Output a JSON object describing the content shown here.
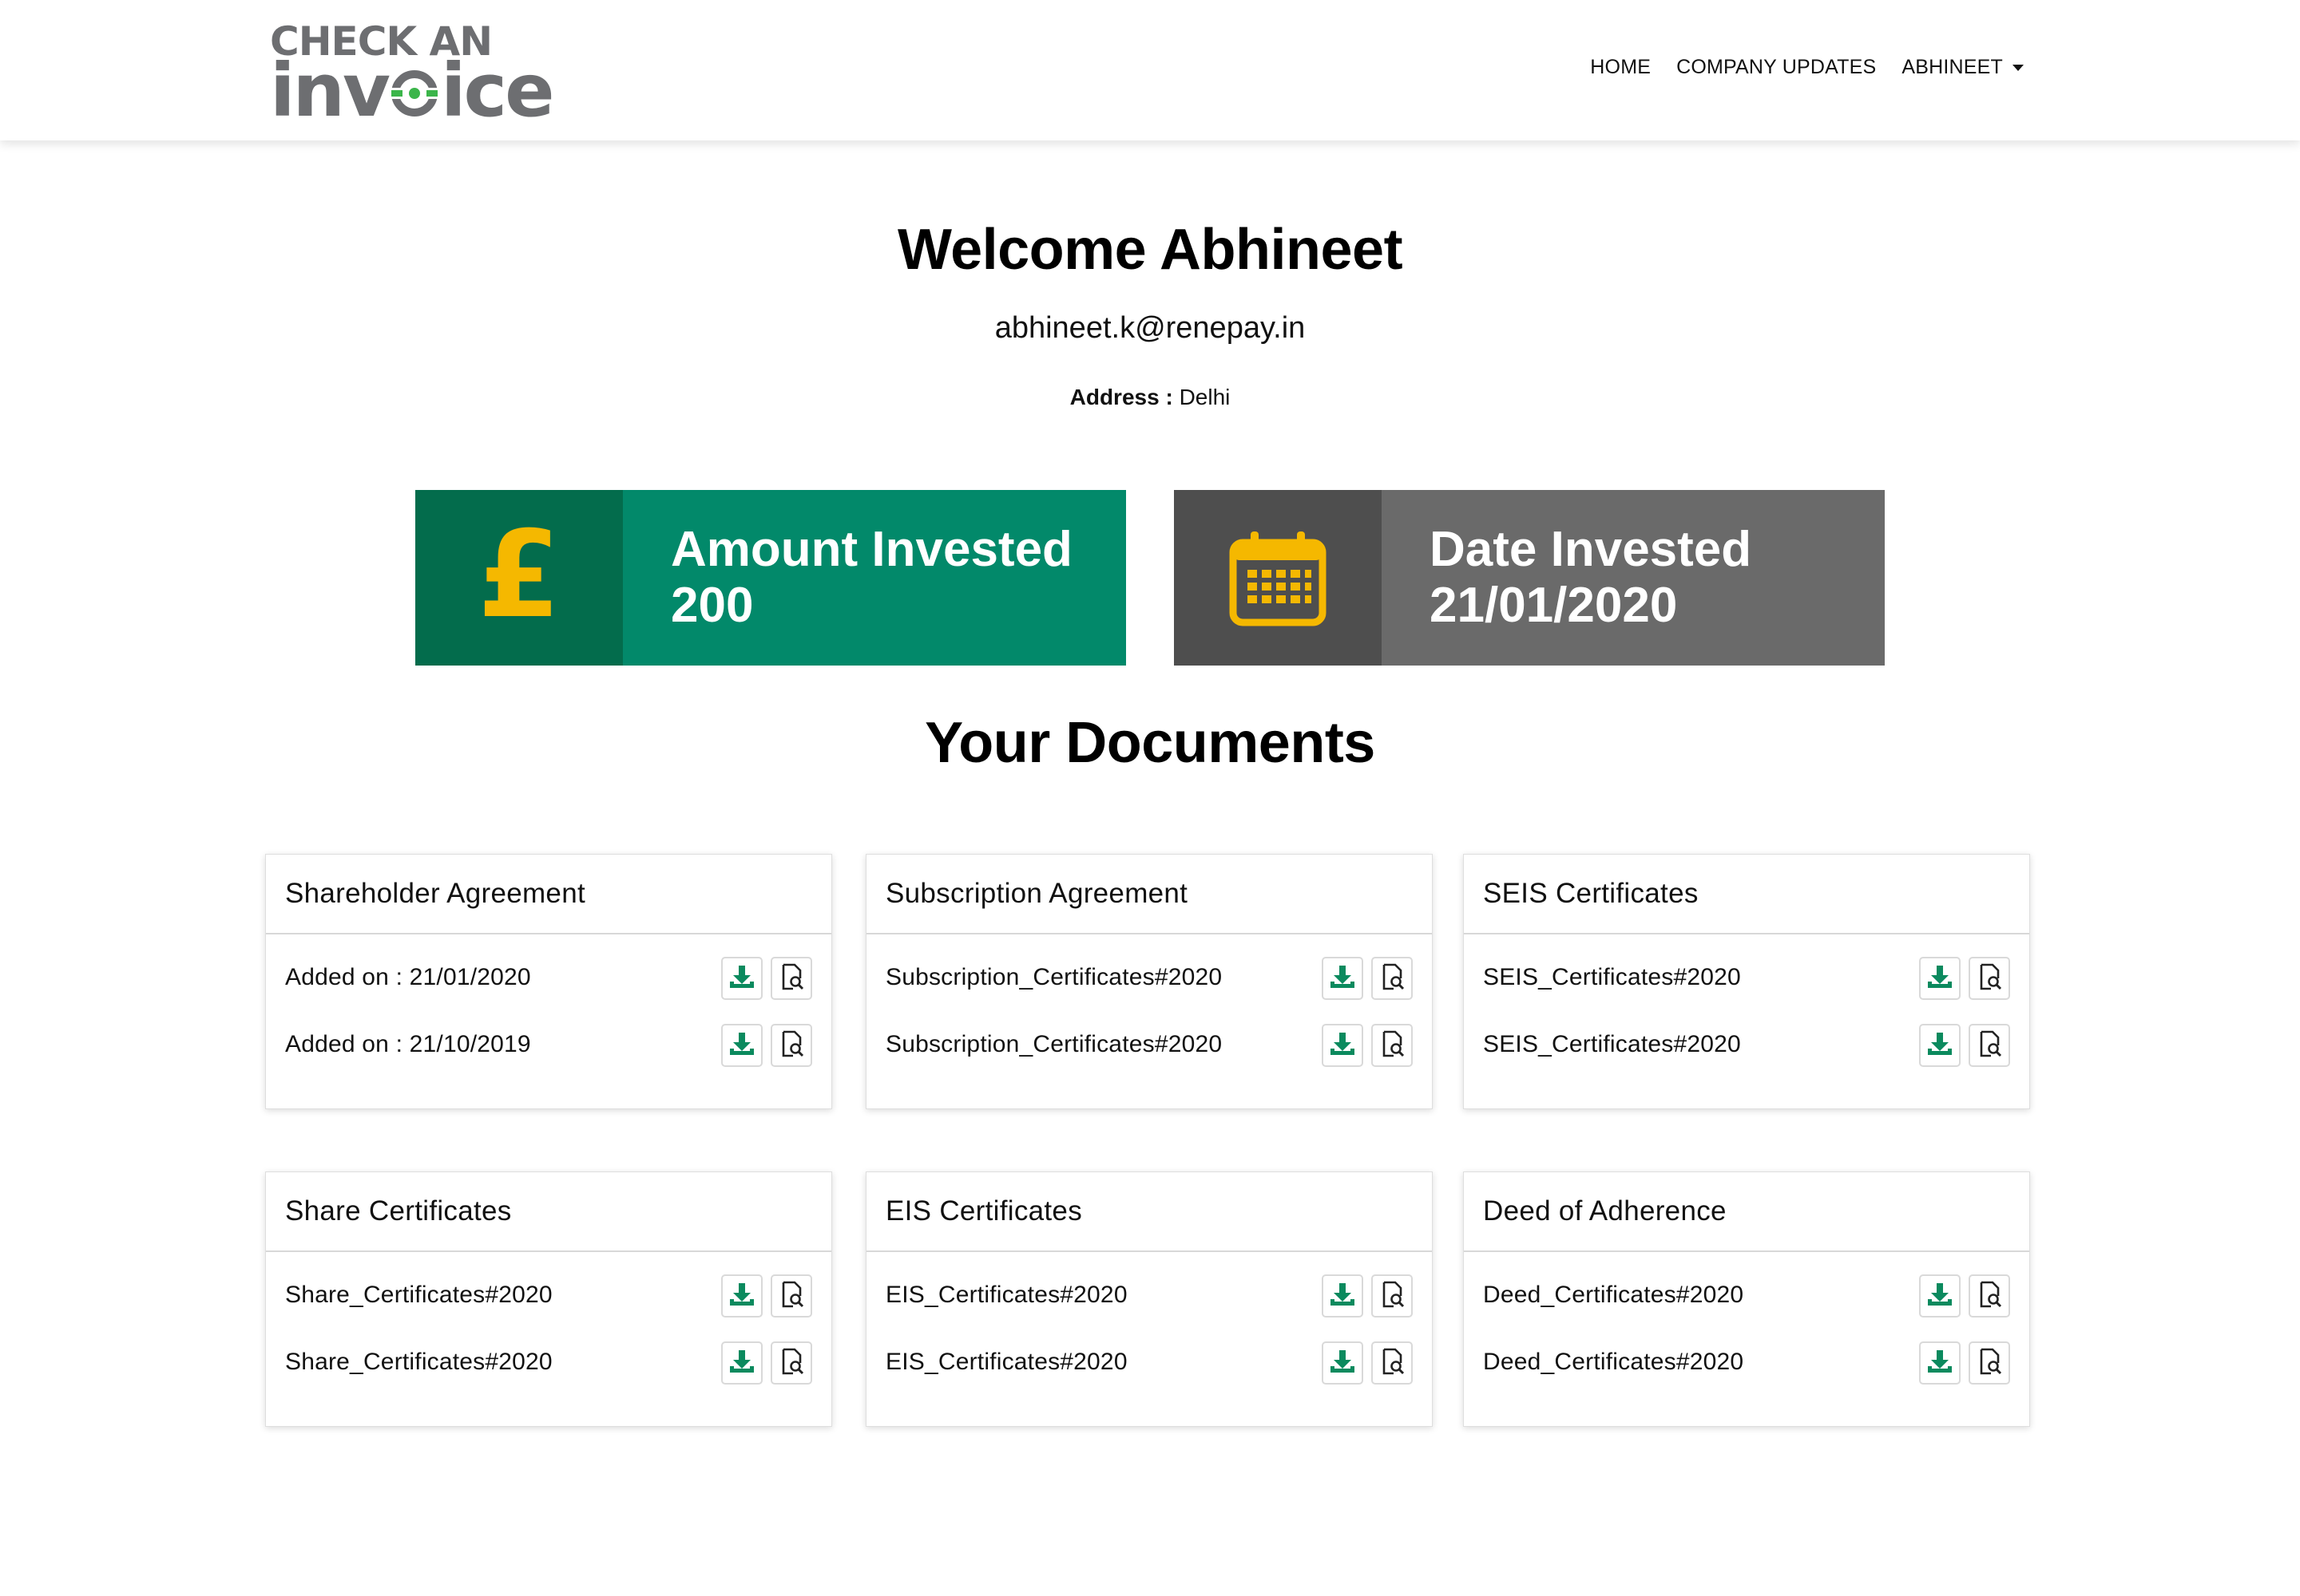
{
  "brand": {
    "logo_top": "CHECK AN",
    "logo_bottom_left": "inv",
    "logo_bottom_right": "ice",
    "eye_color": "#3bb54a"
  },
  "nav": {
    "home": "HOME",
    "updates": "COMPANY UPDATES",
    "user": "ABHINEET"
  },
  "profile": {
    "welcome": "Welcome Abhineet",
    "email": "abhineet.k@renepay.in",
    "address_label": "Address :",
    "address_value": "Delhi"
  },
  "stats": {
    "amount": {
      "label": "Amount Invested",
      "value": "200",
      "icon": "pound-icon"
    },
    "date": {
      "label": "Date Invested",
      "value": "21/01/2020",
      "icon": "calendar-icon"
    }
  },
  "documents": {
    "title": "Your Documents",
    "cards": [
      {
        "title": "Shareholder Agreement",
        "rows": [
          "Added on : 21/01/2020",
          "Added on : 21/10/2019"
        ]
      },
      {
        "title": "Subscription Agreement",
        "rows": [
          "Subscription_Certificates#2020",
          "Subscription_Certificates#2020"
        ]
      },
      {
        "title": "SEIS Certificates",
        "rows": [
          "SEIS_Certificates#2020",
          "SEIS_Certificates#2020"
        ]
      },
      {
        "title": "Share Certificates",
        "rows": [
          "Share_Certificates#2020",
          "Share_Certificates#2020"
        ]
      },
      {
        "title": "EIS Certificates",
        "rows": [
          "EIS_Certificates#2020",
          "EIS_Certificates#2020"
        ]
      },
      {
        "title": "Deed of Adherence",
        "rows": [
          "Deed_Certificates#2020",
          "Deed_Certificates#2020"
        ]
      }
    ]
  },
  "colors": {
    "accent_green": "#02896a",
    "dark_green": "#036c4c",
    "grey": "#6a6a6a",
    "dark_grey": "#4e4e4e",
    "icon_yellow": "#f5b800",
    "download_green": "#0b8a5e"
  },
  "icons": {
    "download": "download-icon",
    "preview": "preview-icon"
  }
}
